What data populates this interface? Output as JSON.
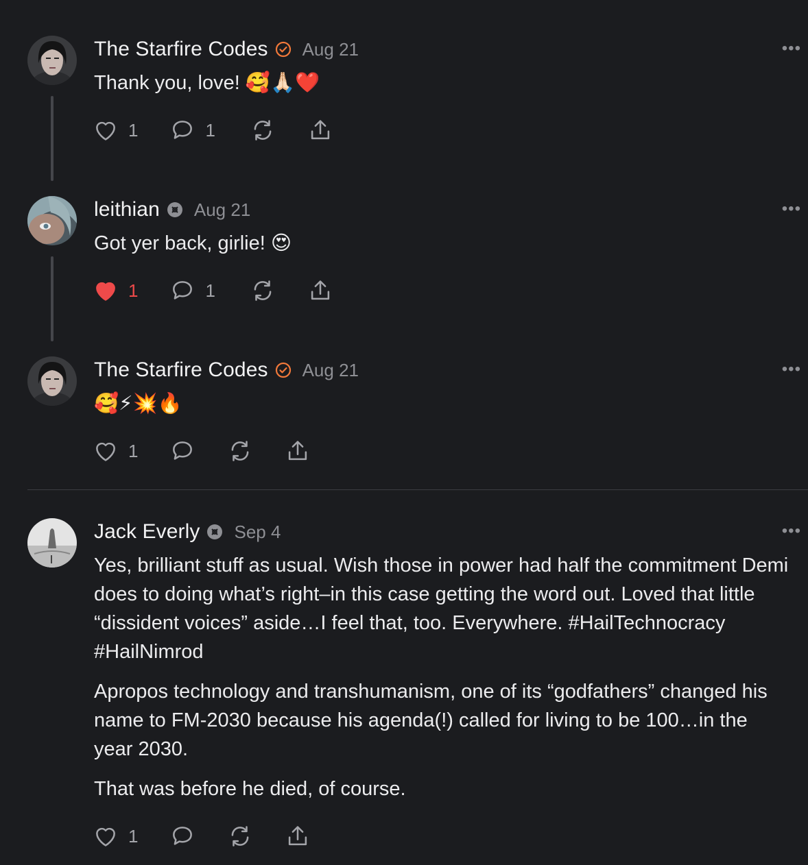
{
  "comments": [
    {
      "author": "The Starfire Codes",
      "badge": "verified-check-icon",
      "date": "Aug 21",
      "text": "Thank you, love! 🥰🙏🏻❤️",
      "likes": "1",
      "replies": "1",
      "liked": false
    },
    {
      "author": "leithian",
      "badge": "subscriber-badge-icon",
      "date": "Aug 21",
      "text": "Got yer back, girlie! 😍",
      "likes": "1",
      "replies": "1",
      "liked": true
    },
    {
      "author": "The Starfire Codes",
      "badge": "verified-check-icon",
      "date": "Aug 21",
      "text": "🥰⚡💥🔥",
      "likes": "1",
      "replies": "",
      "liked": false
    },
    {
      "author": "Jack Everly",
      "badge": "subscriber-badge-icon",
      "date": "Sep 4",
      "paragraphs": [
        "Yes, brilliant stuff as usual. Wish those in power had half the commitment Demi does to doing what’s right–in this case getting the word out. Loved that little “dissident voices” aside…I feel that, too. Everywhere. #HailTechnocracy #HailNimrod",
        "Apropos technology and transhumanism, one of its “godfathers” changed his name to FM-2030 because his agenda(!) called for living to be 100…in the year 2030.",
        "That was before he died, of course."
      ],
      "likes": "1",
      "replies": "",
      "liked": false
    }
  ],
  "more_label": "•••",
  "colors": {
    "background": "#1b1c1f",
    "accent_orange": "#f2793a",
    "like_red": "#ee4a4a",
    "muted": "#8e8f94"
  }
}
